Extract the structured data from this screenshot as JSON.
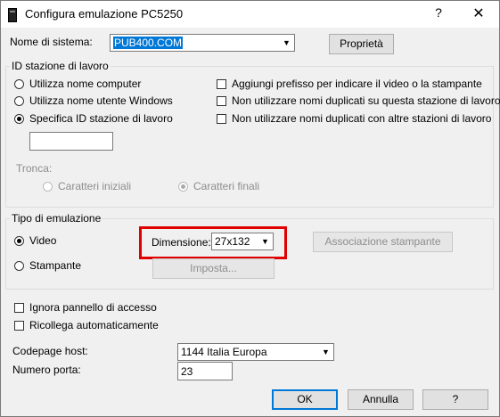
{
  "window": {
    "title": "Configura emulazione PC5250",
    "help_glyph": "?",
    "close_glyph": "✕"
  },
  "system": {
    "label": "Nome di sistema:",
    "value": "PUB400.COM",
    "properties_button": "Proprietà"
  },
  "workstation": {
    "group_label": "ID stazione di lavoro",
    "radios": [
      {
        "label": "Utilizza nome computer",
        "checked": false
      },
      {
        "label": "Utilizza nome utente Windows",
        "checked": false
      },
      {
        "label": "Specifica ID stazione di lavoro",
        "checked": true
      }
    ],
    "checkboxes": [
      {
        "label": "Aggiungi prefisso per indicare il video o la stampante",
        "checked": false
      },
      {
        "label": "Non utilizzare nomi duplicati su questa stazione di lavoro",
        "checked": false
      },
      {
        "label": "Non utilizzare nomi duplicati con altre stazioni di lavoro",
        "checked": false
      }
    ],
    "id_value": "",
    "truncate_label": "Tronca:",
    "truncate_options": [
      {
        "label": "Caratteri iniziali",
        "checked": false
      },
      {
        "label": "Caratteri finali",
        "checked": true
      }
    ]
  },
  "emulation": {
    "group_label": "Tipo di emulazione",
    "video_label": "Video",
    "printer_label": "Stampante",
    "selected": "Video",
    "dimension_label": "Dimensione:",
    "dimension_value": "27x132",
    "printer_assoc_button": "Associazione stampante",
    "setup_button": "Imposta..."
  },
  "options": {
    "ignore_login": "Ignora pannello di accesso",
    "auto_reconnect": "Ricollega automaticamente"
  },
  "codepage": {
    "label": "Codepage host:",
    "value": "1144 Italia Europa"
  },
  "port": {
    "label": "Numero porta:",
    "value": "23"
  },
  "buttons": {
    "ok": "OK",
    "cancel": "Annulla",
    "help": "?"
  },
  "colors": {
    "highlight": "#e00000",
    "selection": "#0078d7"
  }
}
